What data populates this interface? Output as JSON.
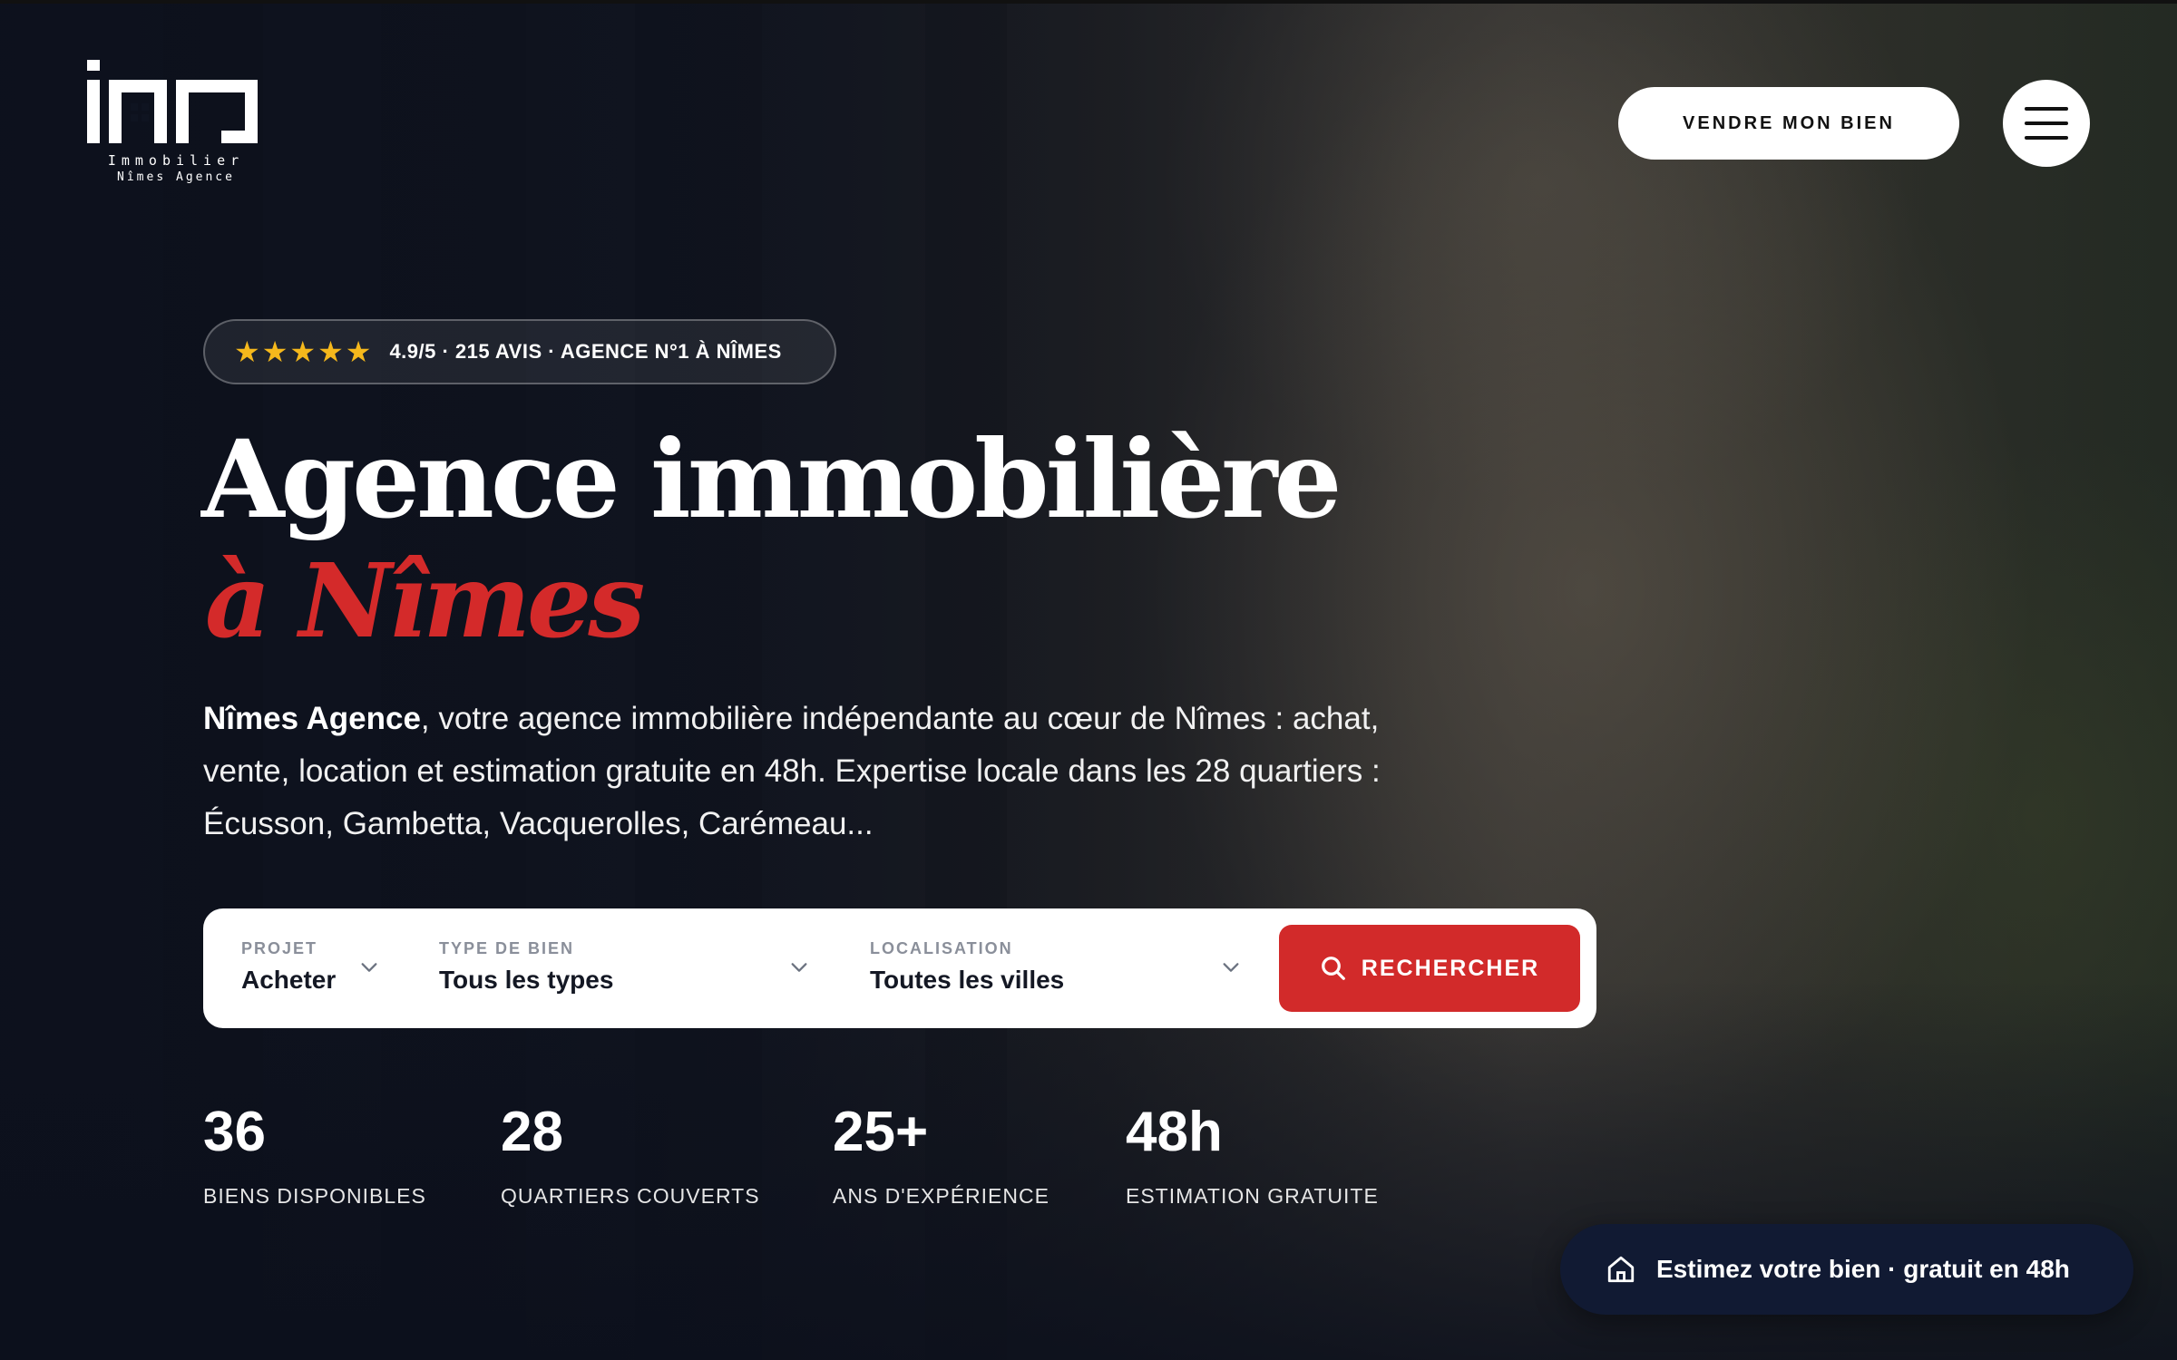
{
  "brand": {
    "logo_text": "ino",
    "subtitle_line1": "Immobilier",
    "subtitle_line2": "Nîmes Agence"
  },
  "header": {
    "sell_button_label": "VENDRE MON BIEN",
    "menu_icon": "hamburger-menu-icon"
  },
  "rating_badge": {
    "stars": "★★★★★",
    "star_color": "#f5b81c",
    "text": "4.9/5 · 215 AVIS · AGENCE N°1 À NÎMES"
  },
  "hero": {
    "title_line1": "Agence immobilière",
    "title_line2": "à Nîmes",
    "accent_color": "#d42a2a",
    "intro_brand": "Nîmes Agence",
    "intro_rest": ", votre agence immobilière indépendante au cœur de Nîmes : achat, vente, location et estimation gratuite en 48h. Expertise locale dans les 28 quartiers : Écusson, Gambetta, Vacquerolles, Carémeau..."
  },
  "search": {
    "project": {
      "label": "PROJET",
      "value": "Acheter"
    },
    "property_type": {
      "label": "TYPE DE BIEN",
      "value": "Tous les types"
    },
    "location": {
      "label": "LOCALISATION",
      "value": "Toutes les villes"
    },
    "button_label": "RECHERCHER",
    "button_color": "#d22a2a"
  },
  "stats": [
    {
      "value": "36",
      "caption": "BIENS DISPONIBLES"
    },
    {
      "value": "28",
      "caption": "QUARTIERS COUVERTS"
    },
    {
      "value": "25+",
      "caption": "ANS D'EXPÉRIENCE"
    },
    {
      "value": "48h",
      "caption": "ESTIMATION GRATUITE"
    }
  ],
  "estimate_cta": {
    "label": "Estimez votre bien · gratuit en 48h",
    "icon": "home-icon"
  }
}
